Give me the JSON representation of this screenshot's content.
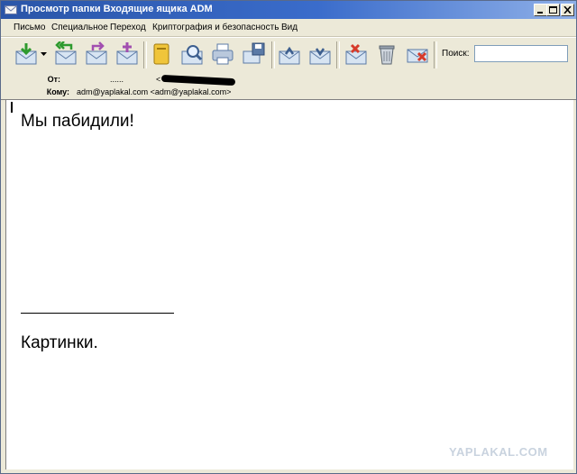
{
  "window": {
    "title": "Просмотр папки Входящие ящика ADM"
  },
  "menu": [
    "Письмо",
    "Специальное",
    "Переход",
    "Криптография и безопасность",
    "Вид"
  ],
  "toolbar": {
    "buttons": [
      "get-mail",
      "dropdown",
      "reply-all",
      "forward",
      "compose",
      "address-book",
      "find",
      "print",
      "save",
      "move-up",
      "move-down",
      "delete",
      "trash",
      "delete-all"
    ],
    "search_label": "Поиск:",
    "search_value": ""
  },
  "header": {
    "from_label": "От:",
    "from_name": "......",
    "from_email_prefix": "<",
    "to_label": "Кому:",
    "to_value": "adm@yaplakal.com <adm@yaplakal.com>"
  },
  "body": {
    "line1": "Мы пабидили!",
    "line2": "Картинки."
  },
  "watermark": "YAPLAKAL.COM",
  "colors": {
    "titlebar": "#2a55a8",
    "chrome": "#ece9d8"
  }
}
